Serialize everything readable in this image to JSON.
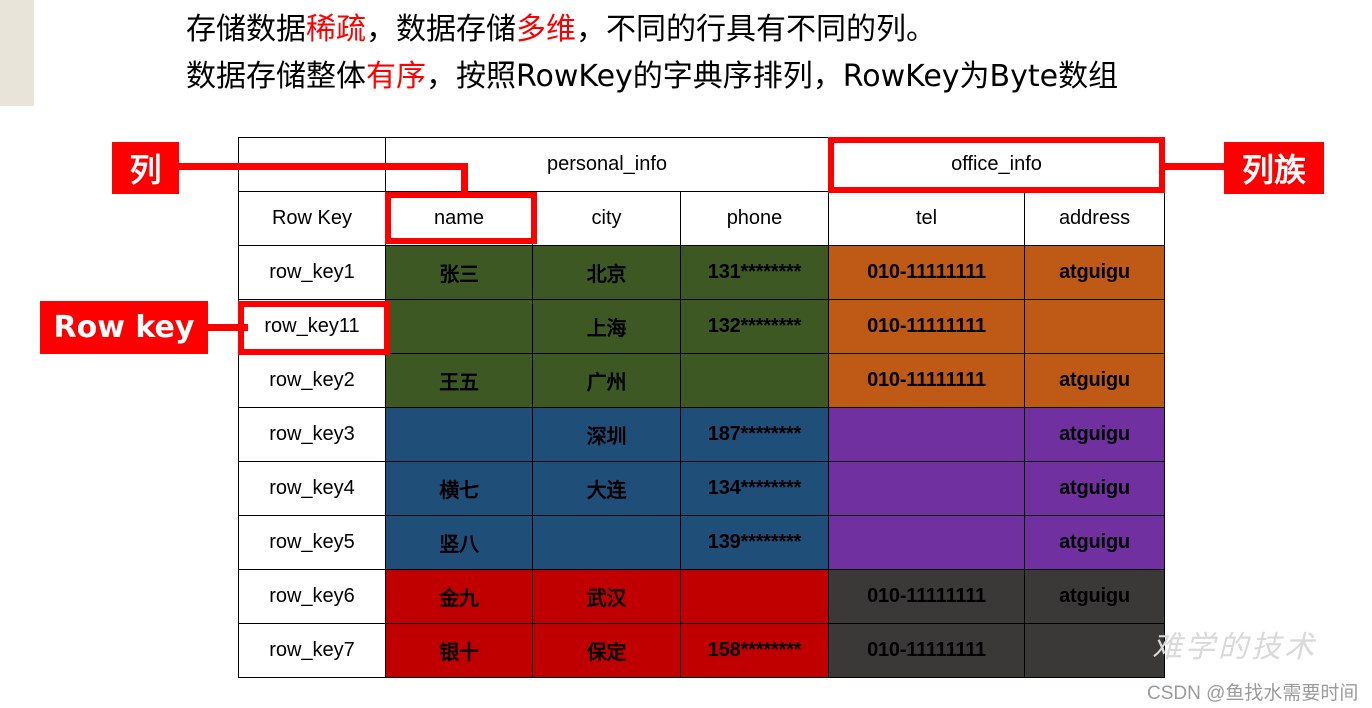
{
  "intro": {
    "line1_part1": "存储数据",
    "line1_hl1": "稀疏",
    "line1_part2": "，数据存储",
    "line1_hl2": "多维",
    "line1_part3": "，不同的行具有不同的列。",
    "line2_part1": "数据存储整体",
    "line2_hl1": "有序",
    "line2_part2": "，按照RowKey的字典序排列，RowKey为Byte数组"
  },
  "annotations": {
    "column": "列",
    "row_key": "Row key",
    "column_family": "列族"
  },
  "table": {
    "column_families": [
      {
        "label": "",
        "span": 1
      },
      {
        "label": "personal_info",
        "span": 3
      },
      {
        "label": "office_info",
        "span": 2
      }
    ],
    "headers": [
      "Row Key",
      "name",
      "city",
      "phone",
      "tel",
      "address"
    ],
    "rows": [
      {
        "row_key": "row_key1",
        "personal_color": "#3d5822",
        "office_color": "#bf5a16",
        "name": "张三",
        "city": "北京",
        "phone": "131********",
        "tel": "010-11111111",
        "address": "atguigu"
      },
      {
        "row_key": "row_key11",
        "personal_color": "#3d5822",
        "office_color": "#bf5a16",
        "name": "",
        "city": "上海",
        "phone": "132********",
        "tel": "010-11111111",
        "address": ""
      },
      {
        "row_key": "row_key2",
        "personal_color": "#3d5822",
        "office_color": "#bf5a16",
        "name": "王五",
        "city": "广州",
        "phone": "",
        "tel": "010-11111111",
        "address": "atguigu"
      },
      {
        "row_key": "row_key3",
        "personal_color": "#1f4e79",
        "office_color": "#7030a0",
        "name": "",
        "city": "深圳",
        "phone": "187********",
        "tel": "",
        "address": "atguigu"
      },
      {
        "row_key": "row_key4",
        "personal_color": "#1f4e79",
        "office_color": "#7030a0",
        "name": "横七",
        "city": "大连",
        "phone": "134********",
        "tel": "",
        "address": "atguigu"
      },
      {
        "row_key": "row_key5",
        "personal_color": "#1f4e79",
        "office_color": "#7030a0",
        "name": "竖八",
        "city": "",
        "phone": "139********",
        "tel": "",
        "address": "atguigu"
      },
      {
        "row_key": "row_key6",
        "personal_color": "#c00000",
        "office_color": "#3b3838",
        "name": "金九",
        "city": "武汉",
        "phone": "",
        "tel": "010-11111111",
        "address": "atguigu"
      },
      {
        "row_key": "row_key7",
        "personal_color": "#c00000",
        "office_color": "#3b3838",
        "name": "银十",
        "city": "保定",
        "phone": "158********",
        "tel": "010-11111111",
        "address": ""
      }
    ]
  },
  "watermark": {
    "text": "难学的技术",
    "credit": "CSDN @鱼找水需要时间"
  },
  "colors": {
    "accent_red": "#ff0000",
    "green": "#3d5822",
    "orange": "#bf5a16",
    "blue": "#1f4e79",
    "purple": "#7030a0",
    "red": "#c00000",
    "gray": "#3b3838"
  }
}
